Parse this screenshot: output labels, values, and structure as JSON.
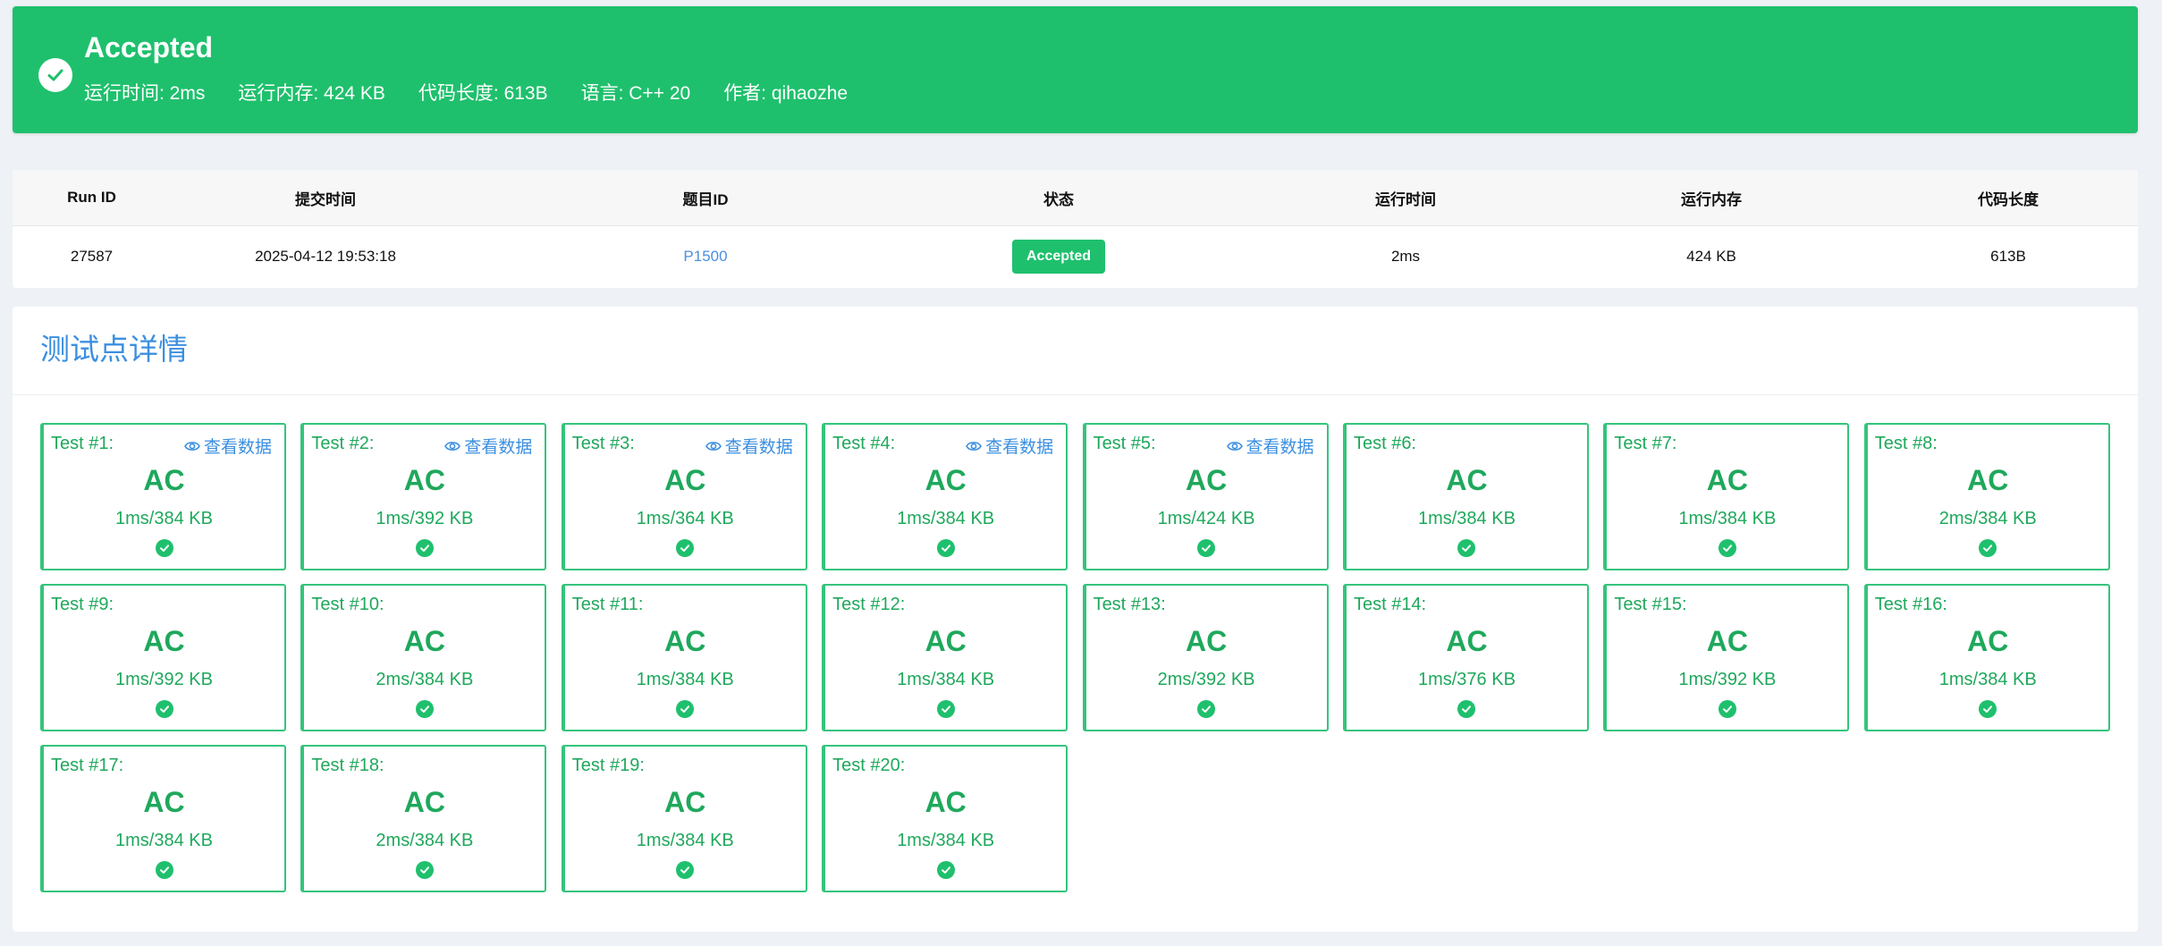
{
  "banner": {
    "title": "Accepted",
    "meta": [
      "运行时间: 2ms",
      "运行内存: 424 KB",
      "代码长度: 613B",
      "语言: C++ 20",
      "作者: qihaozhe"
    ]
  },
  "table": {
    "headers": [
      "Run ID",
      "提交时间",
      "题目ID",
      "状态",
      "运行时间",
      "运行内存",
      "代码长度"
    ],
    "row": {
      "run_id": "27587",
      "submit_time": "2025-04-12 19:53:18",
      "problem_id": "P1500",
      "status": "Accepted",
      "time": "2ms",
      "memory": "424 KB",
      "code_length": "613B"
    }
  },
  "details": {
    "title": "测试点详情",
    "view_label": "查看数据",
    "tests": [
      {
        "label": "Test #1:",
        "status": "AC",
        "metric": "1ms/384 KB",
        "has_view": true
      },
      {
        "label": "Test #2:",
        "status": "AC",
        "metric": "1ms/392 KB",
        "has_view": true
      },
      {
        "label": "Test #3:",
        "status": "AC",
        "metric": "1ms/364 KB",
        "has_view": true
      },
      {
        "label": "Test #4:",
        "status": "AC",
        "metric": "1ms/384 KB",
        "has_view": true
      },
      {
        "label": "Test #5:",
        "status": "AC",
        "metric": "1ms/424 KB",
        "has_view": true
      },
      {
        "label": "Test #6:",
        "status": "AC",
        "metric": "1ms/384 KB",
        "has_view": false
      },
      {
        "label": "Test #7:",
        "status": "AC",
        "metric": "1ms/384 KB",
        "has_view": false
      },
      {
        "label": "Test #8:",
        "status": "AC",
        "metric": "2ms/384 KB",
        "has_view": false
      },
      {
        "label": "Test #9:",
        "status": "AC",
        "metric": "1ms/392 KB",
        "has_view": false
      },
      {
        "label": "Test #10:",
        "status": "AC",
        "metric": "2ms/384 KB",
        "has_view": false
      },
      {
        "label": "Test #11:",
        "status": "AC",
        "metric": "1ms/384 KB",
        "has_view": false
      },
      {
        "label": "Test #12:",
        "status": "AC",
        "metric": "1ms/384 KB",
        "has_view": false
      },
      {
        "label": "Test #13:",
        "status": "AC",
        "metric": "2ms/392 KB",
        "has_view": false
      },
      {
        "label": "Test #14:",
        "status": "AC",
        "metric": "1ms/376 KB",
        "has_view": false
      },
      {
        "label": "Test #15:",
        "status": "AC",
        "metric": "1ms/392 KB",
        "has_view": false
      },
      {
        "label": "Test #16:",
        "status": "AC",
        "metric": "1ms/384 KB",
        "has_view": false
      },
      {
        "label": "Test #17:",
        "status": "AC",
        "metric": "1ms/384 KB",
        "has_view": false
      },
      {
        "label": "Test #18:",
        "status": "AC",
        "metric": "2ms/384 KB",
        "has_view": false
      },
      {
        "label": "Test #19:",
        "status": "AC",
        "metric": "1ms/384 KB",
        "has_view": false
      },
      {
        "label": "Test #20:",
        "status": "AC",
        "metric": "1ms/384 KB",
        "has_view": false
      }
    ]
  },
  "colors": {
    "accepted_green": "#1fc06d",
    "link_blue": "#3b8fe0"
  }
}
